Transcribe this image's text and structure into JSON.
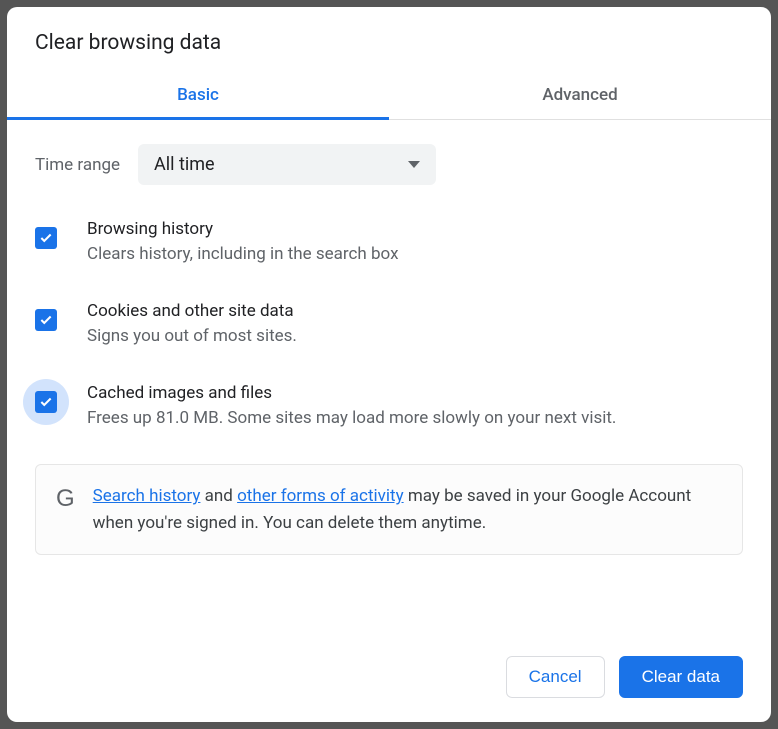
{
  "dialog": {
    "title": "Clear browsing data",
    "tabs": {
      "basic": "Basic",
      "advanced": "Advanced"
    },
    "timeRange": {
      "label": "Time range",
      "selected": "All time"
    },
    "options": [
      {
        "title": "Browsing history",
        "desc": "Clears history, including in the search box",
        "checked": true,
        "ripple": false
      },
      {
        "title": "Cookies and other site data",
        "desc": "Signs you out of most sites.",
        "checked": true,
        "ripple": false
      },
      {
        "title": "Cached images and files",
        "desc": "Frees up 81.0 MB. Some sites may load more slowly on your next visit.",
        "checked": true,
        "ripple": true
      }
    ],
    "info": {
      "link1": "Search history",
      "mid1": " and ",
      "link2": "other forms of activity",
      "tail": " may be saved in your Google Account when you're signed in. You can delete them anytime."
    },
    "buttons": {
      "cancel": "Cancel",
      "clear": "Clear data"
    }
  }
}
